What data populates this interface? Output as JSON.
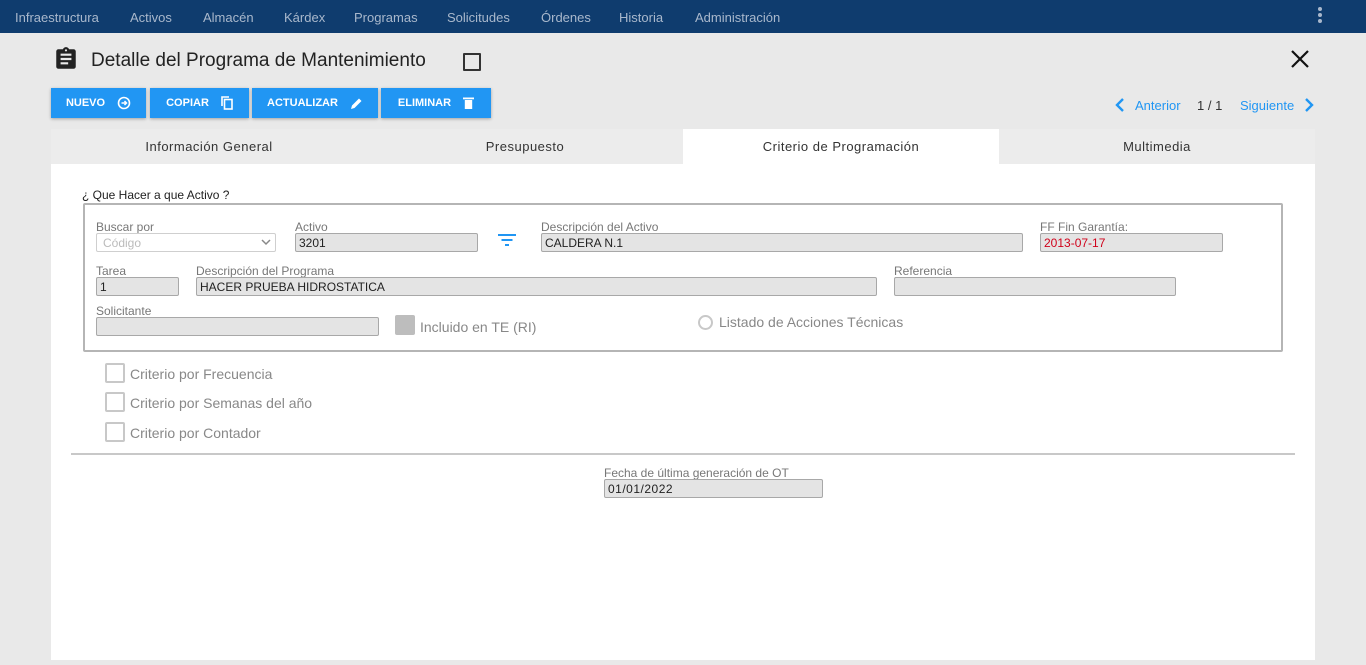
{
  "nav": {
    "items": [
      "Infraestructura",
      "Activos",
      "Almacén",
      "Kárdex",
      "Programas",
      "Solicitudes",
      "Órdenes",
      "Historia",
      "Administración"
    ]
  },
  "header": {
    "title": "Detalle del Programa de Mantenimiento"
  },
  "toolbar": {
    "nuevo": "NUEVO",
    "copiar": "COPIAR",
    "actualizar": "ACTUALIZAR",
    "eliminar": "ELIMINAR"
  },
  "pager": {
    "prev": "Anterior",
    "position": "1 / 1",
    "next": "Siguiente"
  },
  "tabs": [
    "Información General",
    "Presupuesto",
    "Criterio de Programación",
    "Multimedia"
  ],
  "active_tab": "Criterio de Programación",
  "section": {
    "title": "¿ Que Hacer a que Activo ?"
  },
  "form": {
    "buscar_por": {
      "label": "Buscar por",
      "placeholder": "Código"
    },
    "activo": {
      "label": "Activo",
      "value": "3201"
    },
    "descripcion_activo": {
      "label": "Descripción del Activo",
      "value": "CALDERA N.1"
    },
    "ff_fin_garantia": {
      "label": "FF Fin Garantía:",
      "value": "2013-07-17"
    },
    "tarea": {
      "label": "Tarea",
      "value": "1"
    },
    "descripcion_programa": {
      "label": "Descripción del Programa",
      "value": "HACER PRUEBA HIDROSTATICA"
    },
    "referencia": {
      "label": "Referencia",
      "value": ""
    },
    "solicitante": {
      "label": "Solicitante",
      "value": ""
    },
    "incluido_te": {
      "label": "Incluido en TE (RI)"
    },
    "listado_acciones": {
      "label": "Listado de Acciones Técnicas"
    }
  },
  "criterios": [
    {
      "label": "Criterio por Frecuencia",
      "checked": false
    },
    {
      "label": "Criterio por Semanas del año",
      "checked": false
    },
    {
      "label": "Criterio por Contador",
      "checked": false
    }
  ],
  "ultima_generacion": {
    "label": "Fecha de última generación de OT",
    "value": "01/01/2022"
  },
  "colors": {
    "nav_bg": "#0f3c6e",
    "accent": "#2196f3",
    "warning_text": "#d0021b"
  }
}
